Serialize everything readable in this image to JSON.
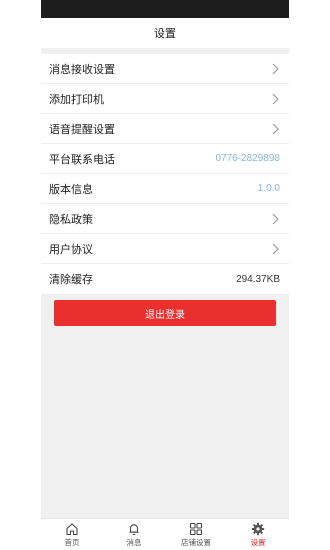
{
  "header": {
    "title": "设置"
  },
  "settings": {
    "items": [
      {
        "label": "消息接收设置",
        "value": ""
      },
      {
        "label": "添加打印机",
        "value": ""
      },
      {
        "label": "语音提醒设置",
        "value": ""
      },
      {
        "label": "平台联系电话",
        "value": "0776-2829898"
      },
      {
        "label": "版本信息",
        "value": "1.0.0"
      },
      {
        "label": "隐私政策",
        "value": ""
      },
      {
        "label": "用户协议",
        "value": ""
      },
      {
        "label": "清除缓存",
        "value": "294.37KB"
      }
    ]
  },
  "logout": {
    "label": "退出登录"
  },
  "tabbar": {
    "tabs": [
      {
        "label": "首页",
        "icon": "home-icon"
      },
      {
        "label": "消息",
        "icon": "bell-icon"
      },
      {
        "label": "店铺设置",
        "icon": "grid-icon"
      },
      {
        "label": "设置",
        "icon": "gear-icon"
      }
    ],
    "active_index": 3
  },
  "colors": {
    "accent_red": "#ea2f2f",
    "link_blue": "#8ab6d6",
    "statusbar": "#1d1d1d",
    "background": "#f0f0f0"
  }
}
